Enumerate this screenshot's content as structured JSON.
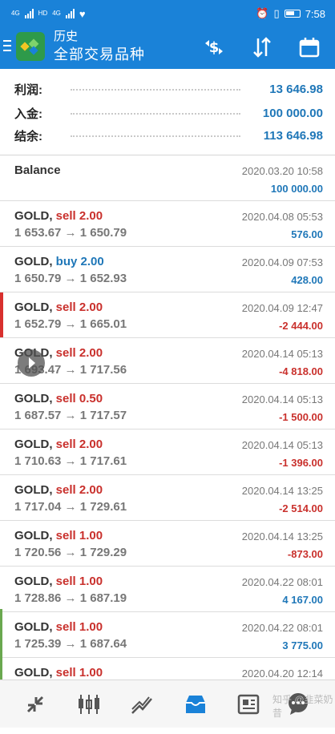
{
  "status_bar": {
    "left_tags": [
      "4G",
      "HD",
      "4G"
    ],
    "time": "7:58"
  },
  "header": {
    "title": "历史",
    "subtitle": "全部交易品种",
    "icons": [
      "menu-icon",
      "metatrader-logo-icon",
      "currency-exchange-icon",
      "sort-icon",
      "calendar-icon"
    ]
  },
  "summary": {
    "rows": [
      {
        "label": "利润:",
        "value": "13 646.98"
      },
      {
        "label": "入金:",
        "value": "100 000.00"
      },
      {
        "label": "结余:",
        "value": "113 646.98"
      }
    ]
  },
  "balance": {
    "label": "Balance",
    "time": "2020.03.20 10:58",
    "amount": "100 000.00"
  },
  "deals": [
    {
      "symbol": "GOLD,",
      "side": "sell 2.00",
      "prices": "1 653.67 → 1 650.79",
      "time": "2020.04.08 05:53",
      "profit": "576.00",
      "type": "sell",
      "sign": "pos"
    },
    {
      "symbol": "GOLD,",
      "side": "buy 2.00",
      "prices": "1 650.79 → 1 652.93",
      "time": "2020.04.09 07:53",
      "profit": "428.00",
      "type": "buy",
      "sign": "pos"
    },
    {
      "symbol": "GOLD,",
      "side": "sell 2.00",
      "prices": "1 652.79 → 1 665.01",
      "time": "2020.04.09 12:47",
      "profit": "-2 444.00",
      "type": "sell",
      "sign": "neg"
    },
    {
      "symbol": "GOLD,",
      "side": "sell 2.00",
      "prices": "1 693.47 → 1 717.56",
      "time": "2020.04.14 05:13",
      "profit": "-4 818.00",
      "type": "sell",
      "sign": "neg"
    },
    {
      "symbol": "GOLD,",
      "side": "sell 0.50",
      "prices": "1 687.57 → 1 717.57",
      "time": "2020.04.14 05:13",
      "profit": "-1 500.00",
      "type": "sell",
      "sign": "neg"
    },
    {
      "symbol": "GOLD,",
      "side": "sell 2.00",
      "prices": "1 710.63 → 1 717.61",
      "time": "2020.04.14 05:13",
      "profit": "-1 396.00",
      "type": "sell",
      "sign": "neg"
    },
    {
      "symbol": "GOLD,",
      "side": "sell 2.00",
      "prices": "1 717.04 → 1 729.61",
      "time": "2020.04.14 13:25",
      "profit": "-2 514.00",
      "type": "sell",
      "sign": "neg"
    },
    {
      "symbol": "GOLD,",
      "side": "sell 1.00",
      "prices": "1 720.56 → 1 729.29",
      "time": "2020.04.14 13:25",
      "profit": "-873.00",
      "type": "sell",
      "sign": "neg"
    },
    {
      "symbol": "GOLD,",
      "side": "sell 1.00",
      "prices": "1 728.86 → 1 687.19",
      "time": "2020.04.22 08:01",
      "profit": "4 167.00",
      "type": "sell",
      "sign": "pos"
    },
    {
      "symbol": "GOLD,",
      "side": "sell 1.00",
      "prices": "1 725.39 → 1 687.64",
      "time": "2020.04.22 08:01",
      "profit": "3 775.00",
      "type": "sell",
      "sign": "pos"
    },
    {
      "symbol": "GOLD,",
      "side": "sell 1.00",
      "prices": "",
      "time": "2020.04.20 12:14",
      "profit": "",
      "type": "sell",
      "sign": "pos"
    }
  ],
  "bottom_nav": {
    "items": [
      "quotes-icon",
      "chart-candles-icon",
      "trade-icon",
      "history-inbox-icon",
      "news-icon",
      "chat-icon"
    ],
    "active": "history-inbox-icon"
  },
  "watermark": "知乎 @韭菜奶昔"
}
